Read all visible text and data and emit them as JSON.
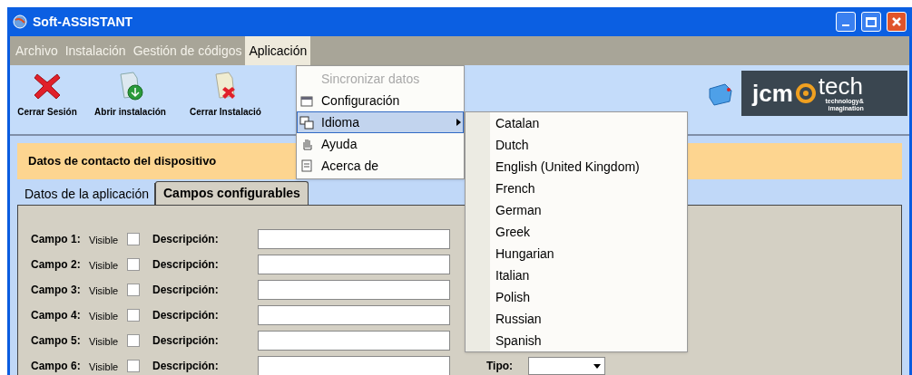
{
  "window": {
    "title": "Soft-ASSISTANT"
  },
  "menubar": [
    {
      "label": "Archivo",
      "selected": false
    },
    {
      "label": "Instalación",
      "selected": false
    },
    {
      "label": "Gestión de códigos",
      "selected": false
    },
    {
      "label": "Aplicación",
      "selected": true
    }
  ],
  "toolbar": [
    {
      "label": "Cerrar Sesión",
      "kind": "close"
    },
    {
      "label": "Abrir instalación",
      "kind": "open"
    },
    {
      "label": "Cerrar Instalació",
      "kind": "closefile"
    }
  ],
  "logo": {
    "brand_left": "jcm",
    "brand_right": "tech",
    "tagline": "technology& imagination"
  },
  "menu": [
    {
      "label": "Sincronizar datos",
      "disabled": true,
      "kind": "none",
      "submenu": false,
      "selected": false
    },
    {
      "label": "Configuración",
      "disabled": false,
      "kind": "config",
      "submenu": false,
      "selected": false
    },
    {
      "label": "Idioma",
      "disabled": false,
      "kind": "language",
      "submenu": true,
      "selected": true
    },
    {
      "label": "Ayuda",
      "disabled": false,
      "kind": "help",
      "submenu": false,
      "selected": false
    },
    {
      "label": "Acerca de",
      "disabled": false,
      "kind": "about",
      "submenu": false,
      "selected": false
    }
  ],
  "languages": [
    "Catalan",
    "Dutch",
    "English (United Kingdom)",
    "French",
    "German",
    "Greek",
    "Hungarian",
    "Italian",
    "Polish",
    "Russian",
    "Spanish"
  ],
  "section_title": "Datos de contacto del dispositivo",
  "tabs": [
    {
      "label": "Datos de la aplicación",
      "selected": false
    },
    {
      "label": "Campos configurables",
      "selected": true
    }
  ],
  "fields": [
    {
      "label": "Campo 1:",
      "visible_label": "Visible",
      "visible": false,
      "description_label": "Descripción:"
    },
    {
      "label": "Campo 2:",
      "visible_label": "Visible",
      "visible": false,
      "description_label": "Descripción:"
    },
    {
      "label": "Campo 3:",
      "visible_label": "Visible",
      "visible": false,
      "description_label": "Descripción:"
    },
    {
      "label": "Campo 4:",
      "visible_label": "Visible",
      "visible": false,
      "description_label": "Descripción:"
    },
    {
      "label": "Campo 5:",
      "visible_label": "Visible",
      "visible": false,
      "description_label": "Descripción:"
    },
    {
      "label": "Campo 6:",
      "visible_label": "Visible",
      "visible": false,
      "description_label": "Descripción:",
      "type_label": "Tipo:"
    }
  ]
}
